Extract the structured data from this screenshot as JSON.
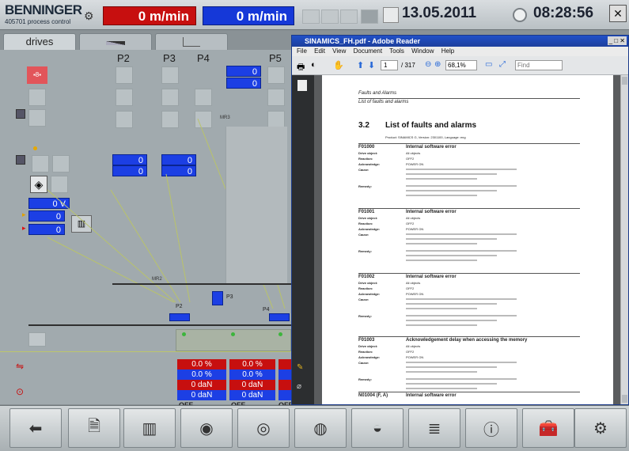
{
  "header": {
    "brand": "BENNINGER",
    "brand_sub": "405701 process control",
    "speed_actual": "0 m/min",
    "speed_set": "0 m/min",
    "date": "13.05.2011",
    "time": "08:28:56"
  },
  "tabs": [
    {
      "label": "drives"
    },
    {
      "label": ""
    },
    {
      "label": ""
    }
  ],
  "main": {
    "drive_labels": [
      "P2",
      "P3",
      "P4",
      "P5"
    ],
    "field_zero": "0",
    "voltage": "0 V",
    "label_mr3": "MR3",
    "label_mr2": "MR2",
    "label_p2": "P2",
    "label_p3": "P3",
    "label_p4": "P4",
    "percent": "0.0 %",
    "force": "0 daN",
    "off": "OFF"
  },
  "acrobat": {
    "title": "SINAMICS_FH.pdf - Adobe Reader",
    "menu": [
      "File",
      "Edit",
      "View",
      "Document",
      "Tools",
      "Window",
      "Help"
    ],
    "page_current": "1",
    "page_total": "/ 317",
    "zoom": "68,1%",
    "find_placeholder": "Find",
    "doc": {
      "running_header": "Faults and Alarms",
      "running_sub": "List of faults and alarms",
      "section_num": "3.2",
      "section_title": "List of faults and alarms",
      "product_line": "Product: SINAMICS G, Version: 2301100, Language: eng",
      "faults": [
        {
          "code": "F01000",
          "title": "Internal software error"
        },
        {
          "code": "F01001",
          "title": "Internal software error"
        },
        {
          "code": "F01002",
          "title": "Internal software error"
        },
        {
          "code": "F01003",
          "title": "Acknowledgement delay when accessing the memory"
        },
        {
          "code": "N01004 (F, A)",
          "title": "Internal software error"
        }
      ],
      "field_labels": [
        "Drive object:",
        "Reaction:",
        "Acknowledge:",
        "Cause:",
        "Remedy:"
      ],
      "field_values": [
        "All objects",
        "OFF2",
        "POWER ON"
      ]
    }
  },
  "colors": {
    "alarm_red": "#c70f0f",
    "value_blue": "#1c3fe4"
  }
}
